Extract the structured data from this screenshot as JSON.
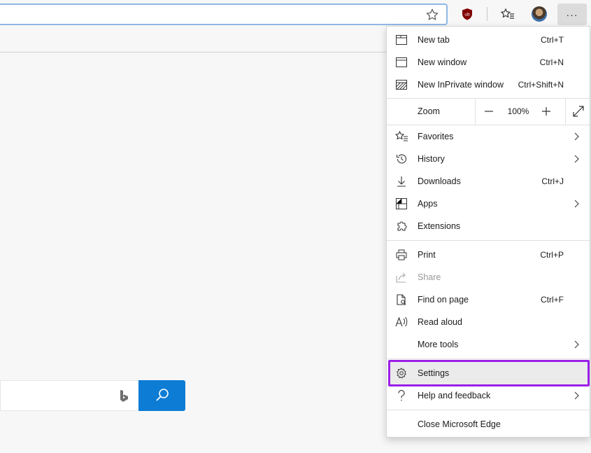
{
  "toolbar": {
    "more_label": "···"
  },
  "menu": {
    "new_tab": {
      "label": "New tab",
      "shortcut": "Ctrl+T"
    },
    "new_window": {
      "label": "New window",
      "shortcut": "Ctrl+N"
    },
    "new_inprivate": {
      "label": "New InPrivate window",
      "shortcut": "Ctrl+Shift+N"
    },
    "zoom": {
      "label": "Zoom",
      "value": "100%",
      "minus": "—",
      "plus": "+"
    },
    "favorites": {
      "label": "Favorites"
    },
    "history": {
      "label": "History"
    },
    "downloads": {
      "label": "Downloads",
      "shortcut": "Ctrl+J"
    },
    "apps": {
      "label": "Apps"
    },
    "extensions": {
      "label": "Extensions"
    },
    "print": {
      "label": "Print",
      "shortcut": "Ctrl+P"
    },
    "share": {
      "label": "Share"
    },
    "find": {
      "label": "Find on page",
      "shortcut": "Ctrl+F"
    },
    "read_aloud": {
      "label": "Read aloud"
    },
    "more_tools": {
      "label": "More tools"
    },
    "settings": {
      "label": "Settings"
    },
    "help": {
      "label": "Help and feedback"
    },
    "close": {
      "label": "Close Microsoft Edge"
    }
  },
  "colors": {
    "highlight_border": "#9b1fe8",
    "search_button": "#0c7cd5",
    "address_border": "#8fb8e6"
  },
  "icons": [
    "star-icon",
    "ublock-icon",
    "favorites-bar-icon",
    "avatar",
    "more-icon",
    "bing-logo",
    "search-icon"
  ]
}
